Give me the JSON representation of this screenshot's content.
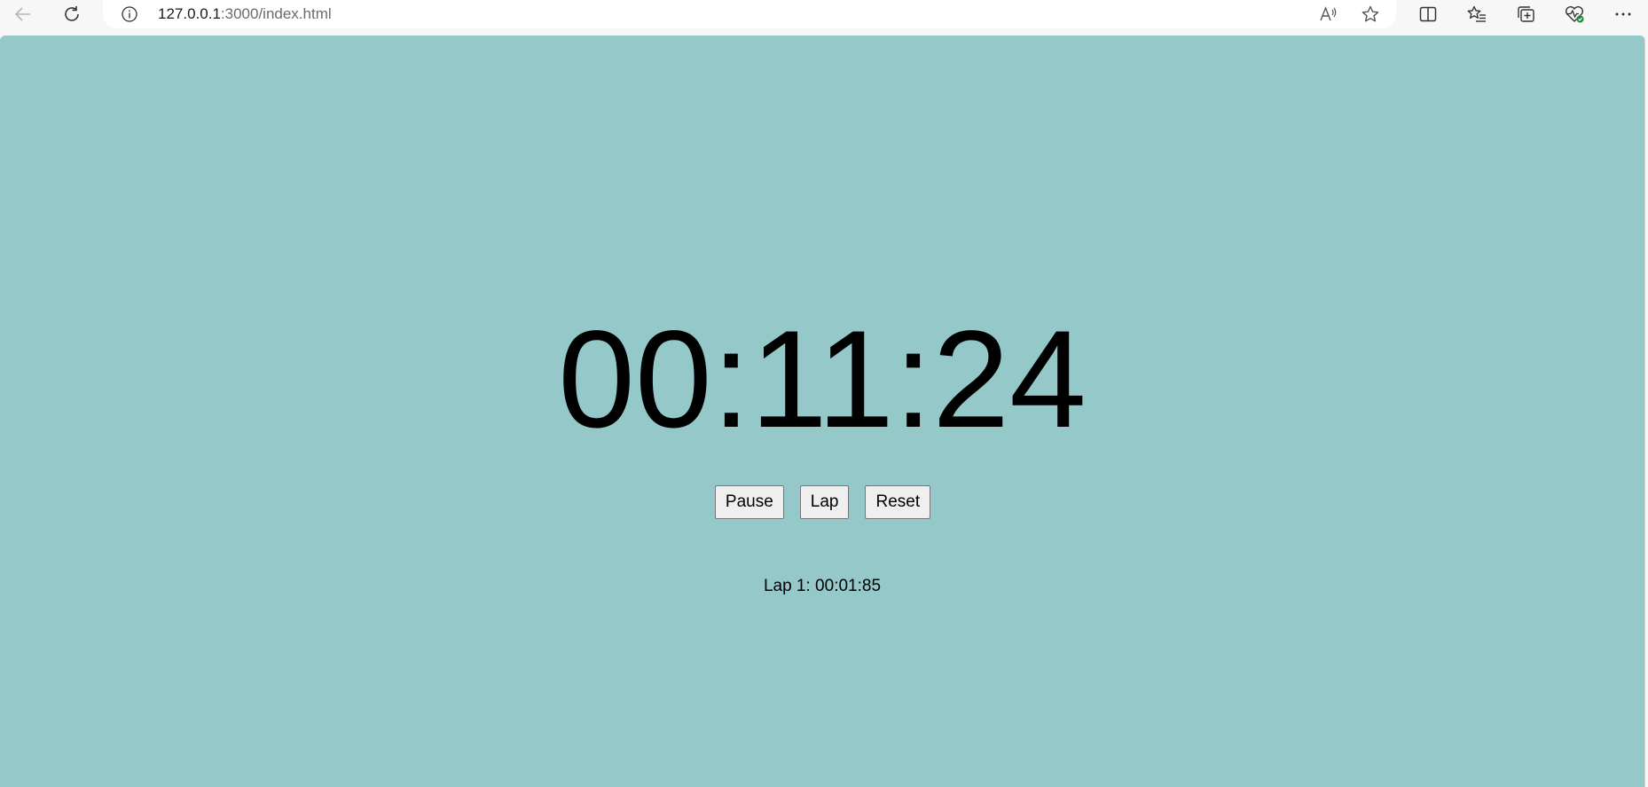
{
  "browser": {
    "url_host": "127.0.0.1",
    "url_rest": ":3000/index.html",
    "icons": {
      "back": "back-arrow-icon",
      "reload": "reload-icon",
      "info": "info-icon",
      "read_aloud": "read-aloud-icon",
      "favorite": "star-icon",
      "split": "split-screen-icon",
      "favorites": "favorites-icon",
      "collections": "collections-icon",
      "health": "browser-essentials-icon",
      "more": "more-icon"
    }
  },
  "stopwatch": {
    "time": "00:11:24",
    "buttons": {
      "pause": "Pause",
      "lap": "Lap",
      "reset": "Reset"
    },
    "laps": [
      "Lap 1: 00:01:85"
    ]
  },
  "colors": {
    "page_background": "#94c8c9",
    "chrome_background": "#f7f7f7"
  }
}
